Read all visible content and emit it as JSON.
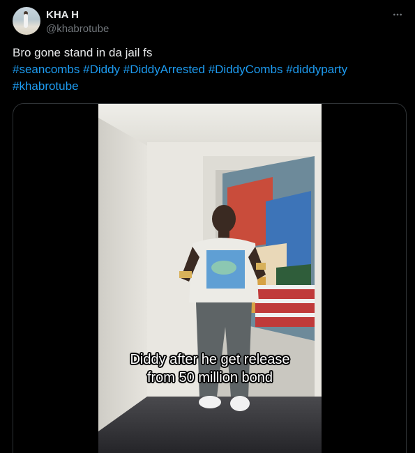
{
  "author": {
    "display_name": "KHA H",
    "handle": "@khabrotube",
    "avatar_icon": "avatar-image"
  },
  "more_icon": "more-horizontal-icon",
  "tweet": {
    "text": "Bro gone stand in da jail fs",
    "hashtags": [
      "#seancombs",
      "#Diddy",
      "#DiddyArrested",
      "#DiddyCombs",
      "#diddyparty",
      "#khabrotube"
    ]
  },
  "video": {
    "caption_line1": "Diddy after he get release",
    "caption_line2": "from 50 million bond"
  },
  "colors": {
    "background": "#000000",
    "text": "#e7e9ea",
    "secondary": "#71767b",
    "link": "#1d9bf0",
    "border": "#2f3336"
  }
}
